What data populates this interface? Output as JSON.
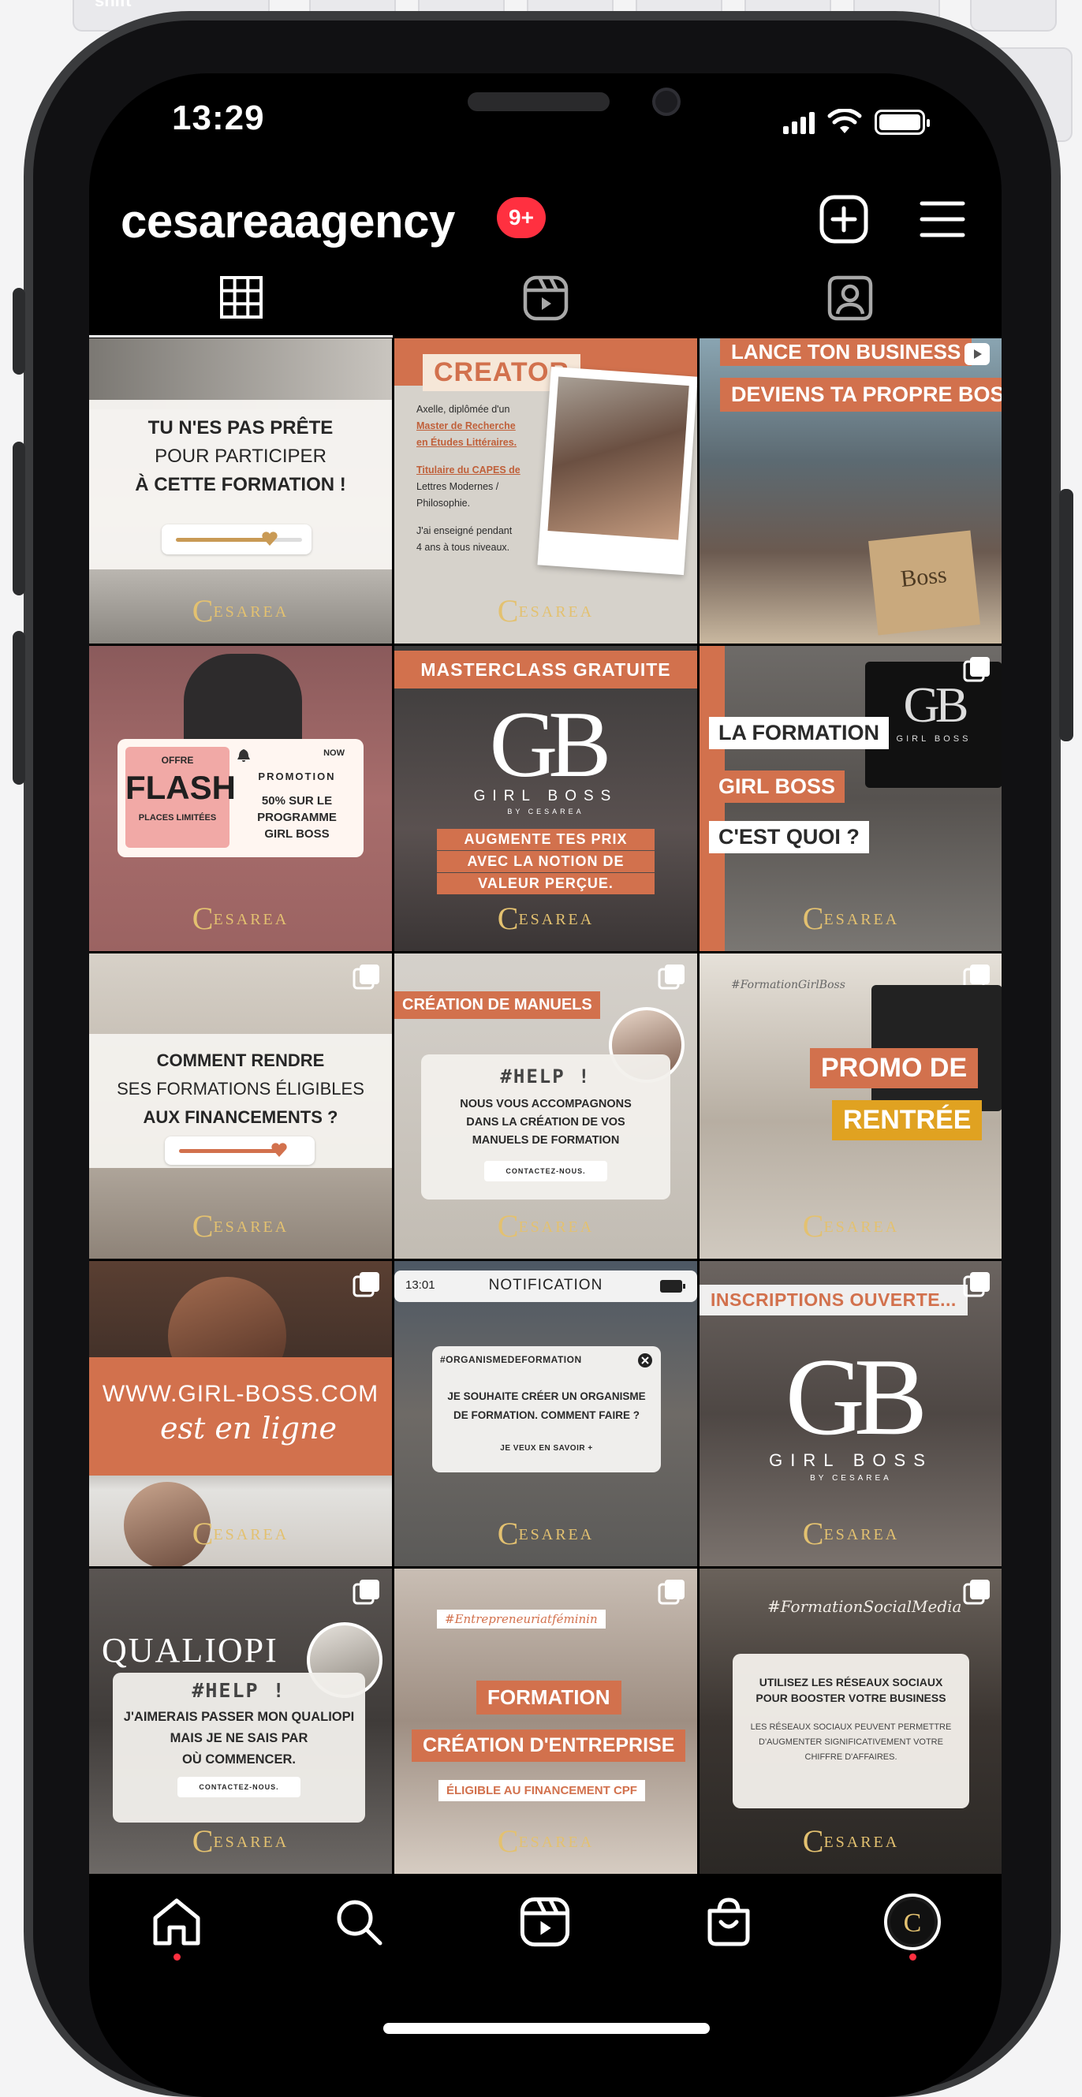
{
  "keyboard": {
    "shift_label": "shift"
  },
  "status_bar": {
    "time": "13:29"
  },
  "profile": {
    "username": "cesareaagency",
    "notification_badge": "9+"
  },
  "header_icons": [
    "new-post-icon",
    "menu-icon"
  ],
  "tabs": [
    "grid-tab",
    "reels-tab",
    "tagged-tab"
  ],
  "posts": [
    {
      "lines": [
        "TU N'ES PAS PRÊTE",
        "POUR PARTICIPER",
        "À CETTE FORMATION !"
      ]
    },
    {
      "heading": "CREATOR",
      "bio": [
        "Axelle, diplômée d'un",
        "Master de Recherche",
        "en Études Littéraires.",
        "Titulaire du CAPES de",
        "Lettres Modernes /",
        "Philosophie.",
        "J'ai enseigné pendant",
        "4 ans à tous niveaux."
      ]
    },
    {
      "lines": [
        "LANCE TON BUSINESS",
        "DEVIENS TA PROPRE BOSS"
      ],
      "bag_text": "Boss"
    },
    {
      "offer": "OFFRE",
      "flash": "FLASH",
      "places": "PLACES LIMITÉES",
      "now": "NOW",
      "promo": "PROMOTION",
      "details": [
        "50% SUR LE",
        "PROGRAMME",
        "GIRL BOSS"
      ]
    },
    {
      "banner": "MASTERCLASS GRATUITE",
      "logo_main": "GB",
      "logo_name": "GIRL BOSS",
      "logo_sub": "BY CESAREA",
      "lines": [
        "AUGMENTE TES PRIX",
        "AVEC LA NOTION DE",
        "VALEUR PERÇUE."
      ]
    },
    {
      "lines": [
        "LA FORMATION",
        "GIRL BOSS",
        "C'EST QUOI ?"
      ],
      "logo_main": "GB",
      "logo_name": "GIRL BOSS"
    },
    {
      "lines": [
        "COMMENT RENDRE",
        "SES FORMATIONS ÉLIGIBLES",
        "AUX FINANCEMENTS ?"
      ]
    },
    {
      "banner": "CRÉATION DE MANUELS",
      "hashtag": "#HELP !",
      "lines": [
        "NOUS VOUS ACCOMPAGNONS",
        "DANS LA CRÉATION DE VOS",
        "MANUELS DE FORMATION"
      ],
      "button": "CONTACTEZ-NOUS."
    },
    {
      "hashtag": "#FormationGirlBoss",
      "lines": [
        "PROMO DE",
        "RENTRÉE"
      ]
    },
    {
      "url": "WWW.GIRL-BOSS.COM",
      "script": "est en ligne"
    },
    {
      "time": "13:01",
      "title": "NOTIFICATION",
      "tag": "#ORGANISMEDEFORMATION",
      "lines": [
        "JE SOUHAITE CRÉER UN ORGANISME",
        "DE FORMATION. COMMENT FAIRE ?"
      ],
      "link": "JE VEUX EN SAVOIR +"
    },
    {
      "banner": "INSCRIPTIONS OUVERTE...",
      "logo_main": "GB",
      "logo_name": "GIRL BOSS",
      "logo_sub": "BY CESAREA"
    },
    {
      "title": "QUALIOPI",
      "hashtag": "#HELP !",
      "lines": [
        "J'AIMERAIS PASSER MON QUALIOPI",
        "MAIS JE NE SAIS PAR",
        "OÙ COMMENCER."
      ],
      "button": "CONTACTEZ-NOUS."
    },
    {
      "hashtag": "#Entrepreneuriatféminin",
      "lines": [
        "FORMATION",
        "CRÉATION D'ENTREPRISE"
      ],
      "sub": "ÉLIGIBLE AU FINANCEMENT CPF"
    },
    {
      "hashtag": "#FormationSocialMedia",
      "title": [
        "UTILISEZ LES RÉSEAUX SOCIAUX",
        "POUR BOOSTER VOTRE BUSINESS"
      ],
      "body": [
        "LES RÉSEAUX SOCIAUX PEUVENT PERMETTRE",
        "D'AUGMENTER SIGNIFICATIVEMENT VOTRE",
        "CHIFFRE D'AFFAIRES."
      ]
    }
  ],
  "logo_text": "ESAREA",
  "logo_letter": "C",
  "bottom_nav": [
    "home-icon",
    "search-icon",
    "reels-icon",
    "shop-icon",
    "profile-avatar"
  ],
  "colors": {
    "brand_orange": "#d2714d",
    "gold": "#e3c170",
    "badge_red": "#ff3040"
  }
}
